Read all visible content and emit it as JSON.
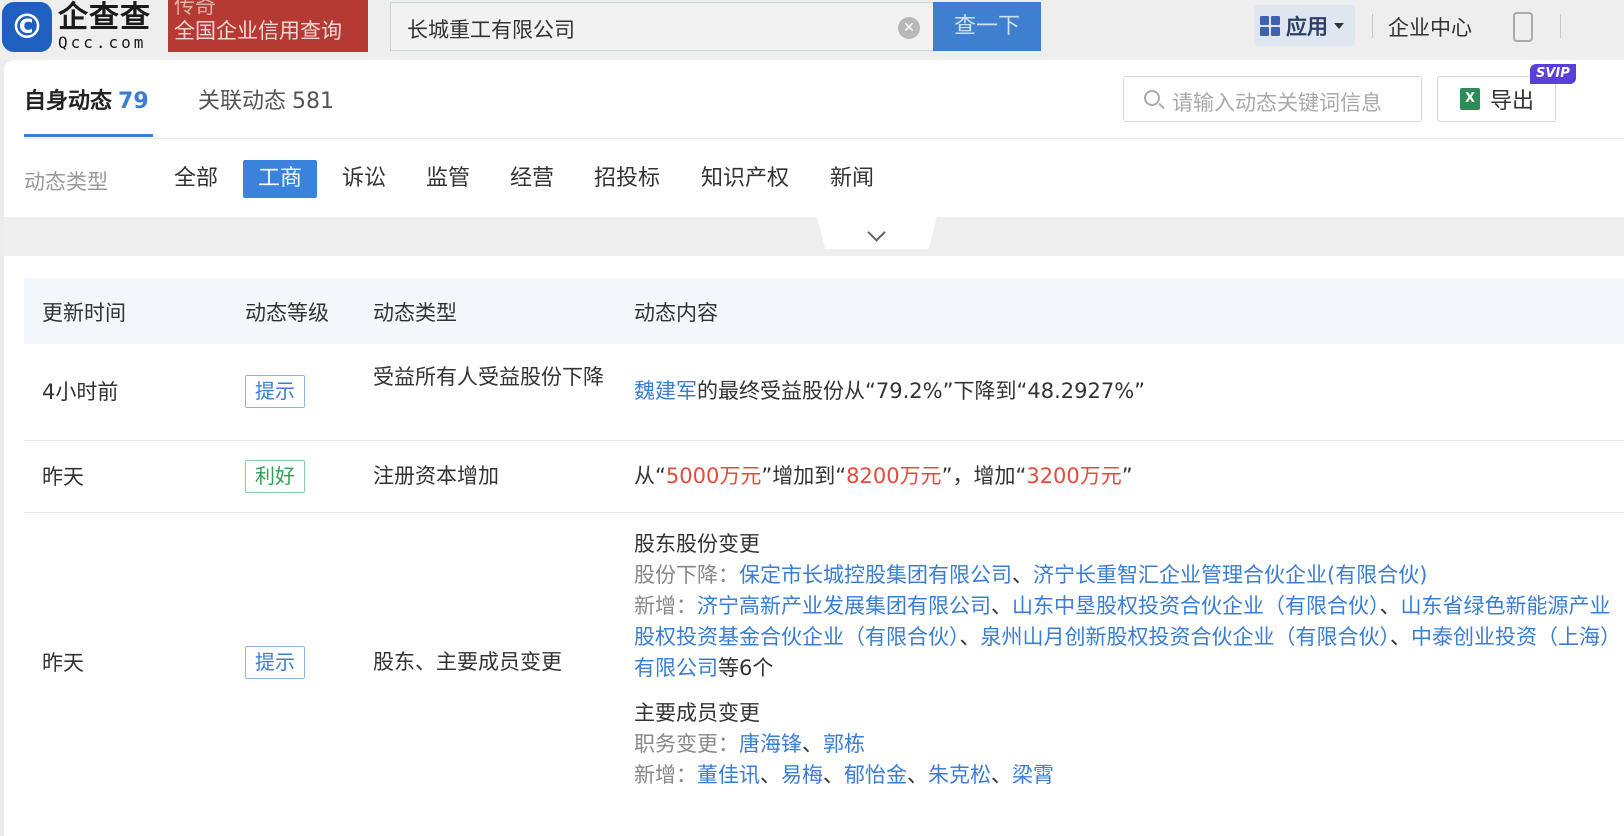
{
  "header": {
    "logo_cn": "企查查",
    "logo_en": "Qcc.com",
    "promo_line1": "传奇",
    "promo_line2": "全国企业信用查询",
    "search_value": "长城重工有限公司",
    "search_button": "查一下",
    "apps_label": "应用",
    "enterprise_center": "企业中心"
  },
  "tabs": {
    "self": {
      "label": "自身动态",
      "count": "79"
    },
    "related": {
      "label": "关联动态",
      "count": "581"
    }
  },
  "keyword_search_placeholder": "请输入动态关键词信息",
  "export_label": "导出",
  "svip_badge": "SVIP",
  "filter": {
    "label": "动态类型",
    "items": [
      "全部",
      "工商",
      "诉讼",
      "监管",
      "经营",
      "招投标",
      "知识产权",
      "新闻"
    ],
    "active": "工商"
  },
  "table": {
    "headers": [
      "更新时间",
      "动态等级",
      "动态类型",
      "动态内容"
    ],
    "rows": [
      {
        "time": "4小时前",
        "level": "提示",
        "type": "受益所有人受益股份下降",
        "content": {
          "person": "魏建军",
          "text_a": "的最终受益股份从“79.2%”下降到“48.2927%”"
        }
      },
      {
        "time": "昨天",
        "level": "利好",
        "type": "注册资本增加",
        "content": {
          "p1": "从“",
          "v1": "5000万元",
          "p2": "”增加到“",
          "v2": "8200万元",
          "p3": "”，增加“",
          "v3": "3200万元",
          "p4": "”"
        }
      },
      {
        "time": "昨天",
        "level": "提示",
        "type": "股东、主要成员变更",
        "content": {
          "section1_title": "股东股份变更",
          "decrease_label": "股份下降：",
          "decrease_items": [
            "保定市长城控股集团有限公司",
            "济宁长重智汇企业管理合伙企业(有限合伙)"
          ],
          "added_label": "新增：",
          "added_items": [
            "济宁高新产业发展集团有限公司",
            "山东中垦股权投资合伙企业（有限合伙）",
            "山东省绿色新能源产业股权投资基金合伙企业（有限合伙）",
            "泉州山月创新股权投资合伙企业（有限合伙）",
            "中泰创业投资（上海）有限公司"
          ],
          "added_suffix": "等6个",
          "section2_title": "主要成员变更",
          "duty_label": "职务变更：",
          "duty_items": [
            "唐海锋",
            "郭栋"
          ],
          "new_member_label": "新增：",
          "new_member_items": [
            "董佳讯",
            "易梅",
            "郁怡金",
            "朱克松",
            "梁霄"
          ]
        }
      }
    ]
  },
  "colors": {
    "accent": "#3a7ed4",
    "red": "#e64a3c",
    "green": "#2aa353",
    "promo": "#b53a33"
  }
}
